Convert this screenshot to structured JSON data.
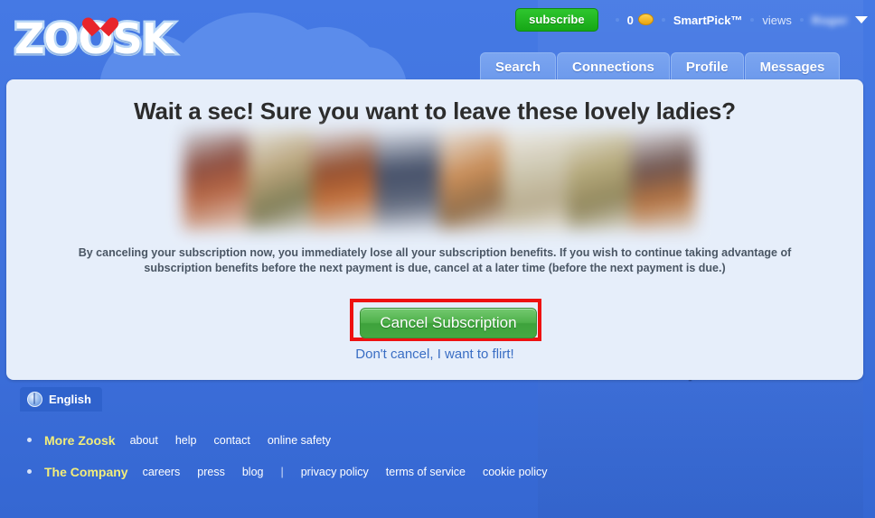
{
  "brand": {
    "logo_text": "ZOOSK",
    "heart_color": "#e8252b",
    "logo_outline_color": "#bcd9f7"
  },
  "header": {
    "subscribe_label": "subscribe",
    "subscribe_color": "#22b822",
    "coin_count": "0",
    "coin_icon": "coin-icon",
    "smartpick_label": "SmartPick™",
    "views_label": "views",
    "username": "Roger",
    "chevron_icon": "chevron-down-icon",
    "tabs": [
      {
        "label": "Search"
      },
      {
        "label": "Connections"
      },
      {
        "label": "Profile"
      },
      {
        "label": "Messages"
      }
    ]
  },
  "dialog": {
    "title": "Wait a sec! Sure you want to leave these lovely ladies?",
    "body": "By canceling your subscription now, you immediately lose all your subscription benefits. If you wish to continue taking advantage of subscription benefits before the next payment is due, cancel at a later time (before the next payment is due.)",
    "cancel_button_label": "Cancel Subscription",
    "cancel_button_color": "#47a844",
    "highlight_color": "#ee1111",
    "flirt_link_label": "Don't cancel, I want to flirt!",
    "flirt_link_color": "#3a6ec4",
    "photo_count": 8
  },
  "language": {
    "icon": "globe-icon",
    "label": "English"
  },
  "footer": {
    "rows": [
      {
        "heading": "More Zoosk",
        "links": [
          "about",
          "help",
          "contact",
          "online safety"
        ],
        "separator_after": -1
      },
      {
        "heading": "The Company",
        "links": [
          "careers",
          "press",
          "blog",
          "privacy policy",
          "terms of service",
          "cookie policy"
        ],
        "separator_after": 2,
        "separator": "|"
      }
    ]
  }
}
